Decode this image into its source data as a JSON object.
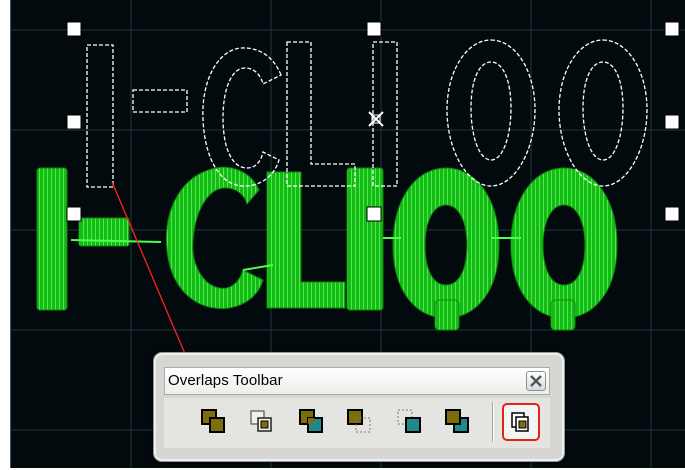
{
  "canvas": {
    "background_color": "#020a0d",
    "stitch_color": "#1fe21f",
    "outline_color": "#ffffff",
    "connector_line_color": "#ff2020",
    "outline_text": "I-CLIOO",
    "stitched_text": "I-CLIOO",
    "selection_handles": [
      "top-left",
      "top-center",
      "top-right",
      "middle-left",
      "middle-right",
      "bottom-left",
      "bottom-center",
      "bottom-right"
    ],
    "center_marker_icon": "x-cross-icon"
  },
  "toolbar": {
    "title": "Overlaps Toolbar",
    "close_icon": "close-x-icon",
    "accent_highlight": "#e2201c",
    "buttons": [
      {
        "id": "overlap-both",
        "icon": "two-filled-olive-squares-icon"
      },
      {
        "id": "overlap-outline",
        "icon": "two-outline-squares-icon"
      },
      {
        "id": "overlap-teal-front",
        "icon": "olive-and-teal-squares-icon"
      },
      {
        "id": "overlap-olive-dashed",
        "icon": "olive-and-dashed-square-icon"
      },
      {
        "id": "overlap-dashed-teal",
        "icon": "dashed-and-teal-square-icon"
      },
      {
        "id": "overlap-olive-front",
        "icon": "teal-and-olive-squares-icon"
      },
      {
        "id": "collapsed-overlaps",
        "icon": "stacked-pages-icon",
        "highlighted": true
      }
    ]
  }
}
